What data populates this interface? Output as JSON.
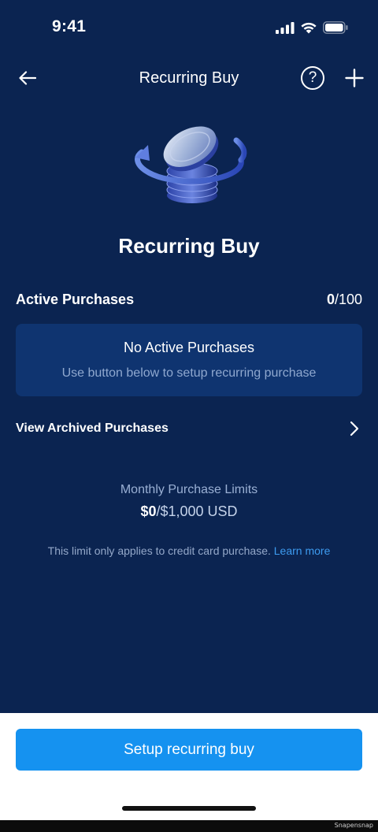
{
  "status_bar": {
    "time": "9:41",
    "icons": [
      "signal-icon",
      "wifi-icon",
      "battery-icon"
    ]
  },
  "nav": {
    "title": "Recurring Buy",
    "back_icon": "back-arrow-icon",
    "help_icon": "help-circle-icon",
    "help_glyph": "?",
    "add_icon": "plus-icon"
  },
  "hero": {
    "illustration": "coin-stack-icon",
    "title": "Recurring Buy"
  },
  "active_purchases": {
    "label": "Active Purchases",
    "count_current": "0",
    "count_max": "/100",
    "empty_title": "No Active Purchases",
    "empty_subtitle": "Use button below to setup recurring purchase"
  },
  "archived": {
    "label": "View Archived Purchases",
    "icon": "chevron-right-icon"
  },
  "limits": {
    "label": "Monthly Purchase Limits",
    "used": "$0",
    "total": "/$1,000 USD",
    "note": "This limit only applies to credit card purchase.",
    "learn_more": "Learn more"
  },
  "cta": {
    "label": "Setup recurring buy"
  },
  "watermark": "Snapensnap",
  "colors": {
    "background": "#0b2451",
    "card": "#0f3470",
    "accent": "#1592f0",
    "link": "#3d9bf0"
  }
}
